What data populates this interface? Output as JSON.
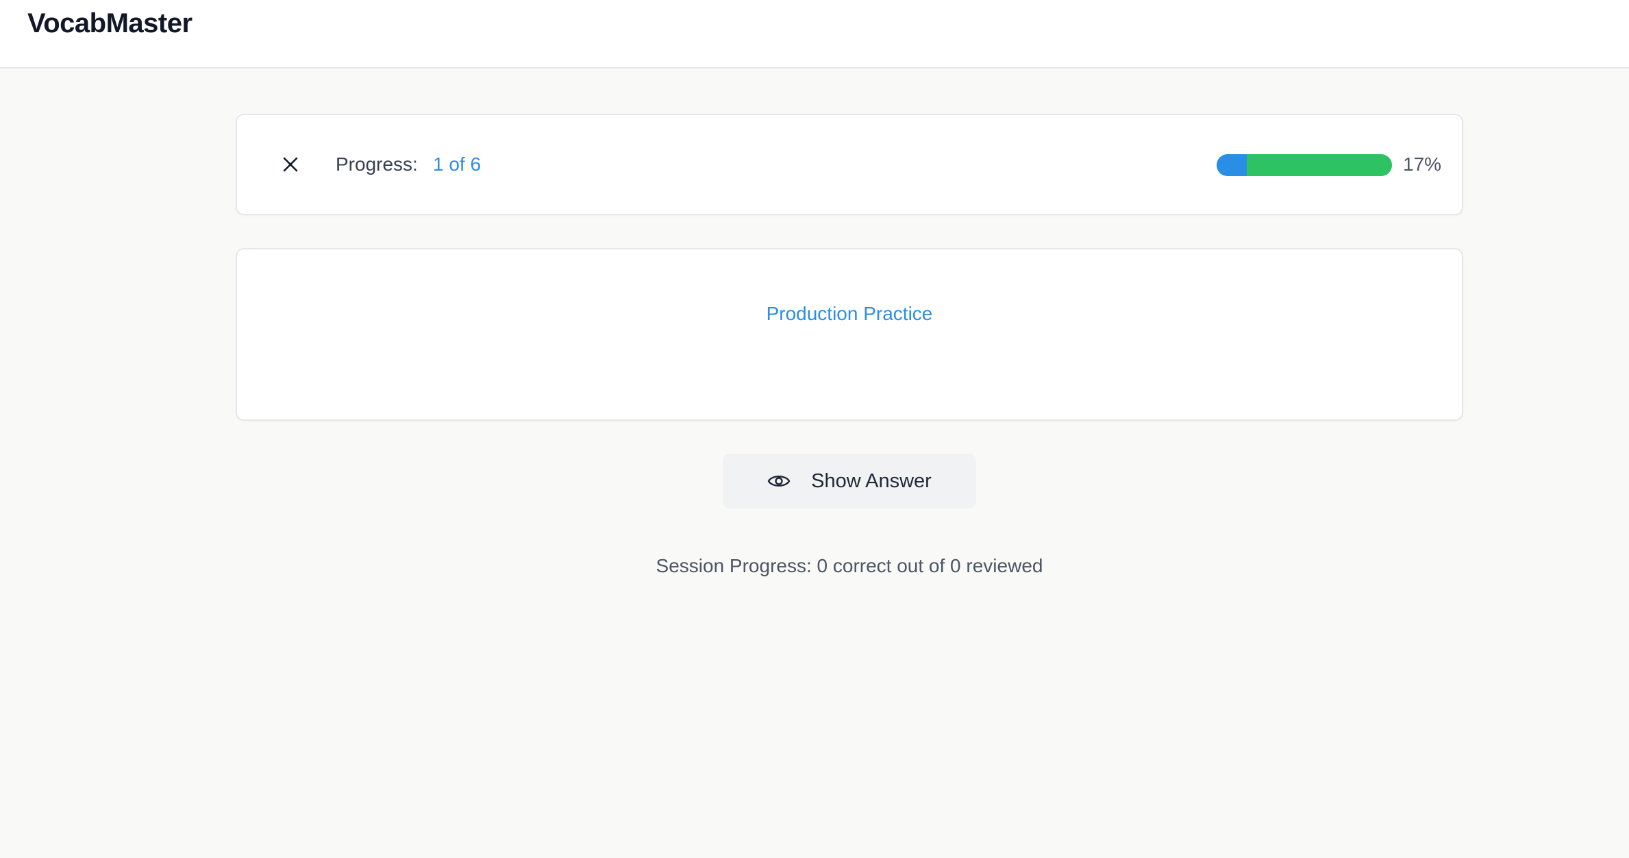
{
  "app": {
    "title": "VocabMaster"
  },
  "progress": {
    "label": "Progress:",
    "count_text": "1 of 6",
    "percent_text": "17%",
    "fraction": 0.17,
    "close_icon": "close-icon"
  },
  "practice": {
    "title": "Production Practice"
  },
  "actions": {
    "show_answer_label": "Show Answer",
    "show_answer_icon": "eye-icon"
  },
  "session": {
    "summary": "Session Progress: 0 correct out of 0 reviewed"
  },
  "colors": {
    "accent": "#2b8ee5",
    "success": "#2dc262",
    "background": "#f9f9f8"
  }
}
